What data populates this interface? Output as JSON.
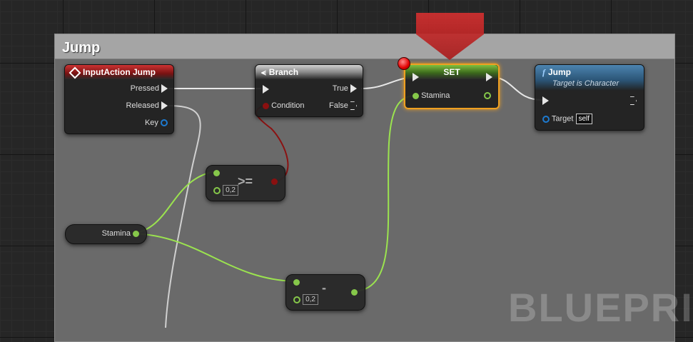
{
  "comment": {
    "title": "Jump"
  },
  "nodes": {
    "input_action": {
      "title": "InputAction Jump",
      "icon": "input-event-icon",
      "pins": {
        "pressed": "Pressed",
        "released": "Released",
        "key": "Key"
      }
    },
    "branch": {
      "title": "Branch",
      "icon": "branch-icon",
      "pins": {
        "condition": "Condition",
        "true": "True",
        "false": "False"
      }
    },
    "set": {
      "title": "SET",
      "pins": {
        "stamina": "Stamina"
      }
    },
    "jump": {
      "title": "Jump",
      "subtitle": "Target is Character",
      "icon": "function-icon",
      "pins": {
        "target": "Target",
        "target_value": "self"
      }
    },
    "compare": {
      "operator": ">=",
      "value": "0,2"
    },
    "subtract": {
      "operator": "-",
      "value": "0,2"
    },
    "stamina_get": {
      "label": "Stamina"
    }
  },
  "watermark": "BLUEPRIN",
  "colors": {
    "exec_wire": "#e8e8e8",
    "float_wire": "#9be34f",
    "bool_wire": "#8b1111",
    "selection": "#f0a020",
    "breakpoint": "#ff2020",
    "arrow": "#c8282c"
  }
}
